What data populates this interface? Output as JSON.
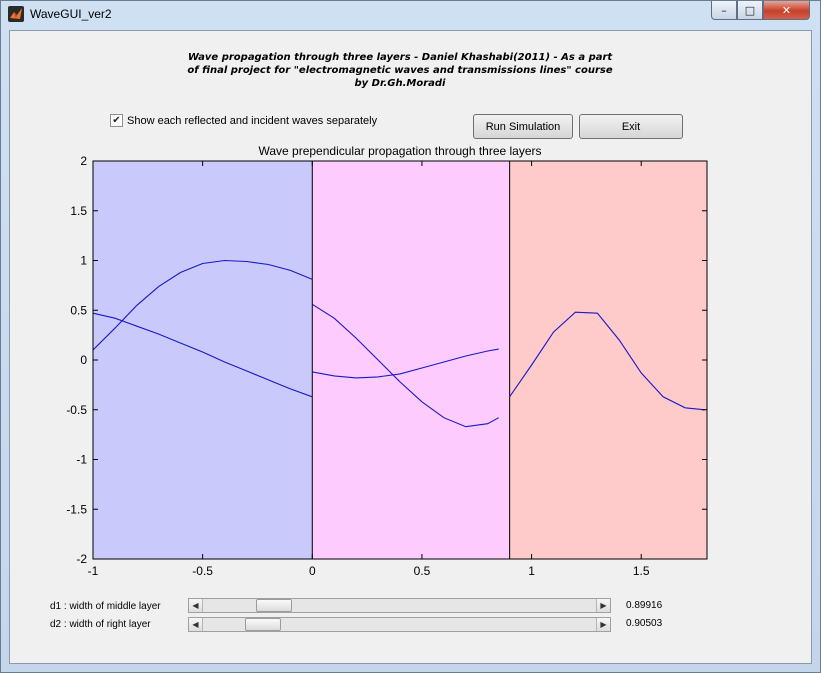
{
  "window": {
    "title": "WaveGUI_ver2",
    "minimize_glyph": "–",
    "maximize_glyph": "□",
    "close_glyph": "✕"
  },
  "header": {
    "line1": "Wave propagation through three layers - Daniel Khashabi(2011) - As a part",
    "line2": "of final project for \"electromagnetic waves and transmissions lines\" course",
    "line3": "by Dr.Gh.Moradi"
  },
  "controls": {
    "checkbox_label": "Show each reflected and incident waves separately",
    "checkbox_checked": true,
    "checkbox_glyph": "✔",
    "run_label": "Run Simulation",
    "exit_label": "Exit"
  },
  "chart_data": {
    "type": "line",
    "title": "Wave prependicular propagation through three layers",
    "xlim": [
      -1,
      1.8
    ],
    "ylim": [
      -2,
      2
    ],
    "x_ticks": [
      "-1",
      "-0.5",
      "0",
      "0.5",
      "1",
      "1.5"
    ],
    "x_tick_values": [
      -1,
      -0.5,
      0,
      0.5,
      1,
      1.5
    ],
    "y_ticks": [
      "2",
      "1.5",
      "1",
      "0.5",
      "0",
      "-0.5",
      "-1",
      "-1.5",
      "-2"
    ],
    "y_tick_values": [
      2,
      1.5,
      1,
      0.5,
      0,
      -0.5,
      -1,
      -1.5,
      -2
    ],
    "grid": false,
    "regions": [
      {
        "x_from": -1,
        "x_to": 0,
        "color": "#c9c9fb"
      },
      {
        "x_from": 0,
        "x_to": 0.9,
        "color": "#fecbfe"
      },
      {
        "x_from": 0.9,
        "x_to": 1.8,
        "color": "#fecbca"
      }
    ],
    "line_color": "#1818c8",
    "series": [
      {
        "x": [
          -1,
          -0.9,
          -0.8,
          -0.7,
          -0.6,
          -0.5,
          -0.4,
          -0.3,
          -0.2,
          -0.1,
          0
        ],
        "y": [
          0.1,
          0.32,
          0.55,
          0.74,
          0.88,
          0.97,
          1.0,
          0.99,
          0.96,
          0.9,
          0.81
        ]
      },
      {
        "x": [
          -1,
          -0.9,
          -0.8,
          -0.7,
          -0.6,
          -0.5,
          -0.4,
          -0.3,
          -0.2,
          -0.1,
          0
        ],
        "y": [
          0.47,
          0.42,
          0.34,
          0.26,
          0.17,
          0.08,
          -0.02,
          -0.11,
          -0.2,
          -0.29,
          -0.37
        ]
      },
      {
        "x": [
          0,
          0.1,
          0.2,
          0.3,
          0.4,
          0.5,
          0.6,
          0.7,
          0.8,
          0.85
        ],
        "y": [
          0.56,
          0.42,
          0.22,
          0.0,
          -0.22,
          -0.42,
          -0.58,
          -0.67,
          -0.64,
          -0.58
        ]
      },
      {
        "x": [
          0,
          0.1,
          0.2,
          0.3,
          0.4,
          0.5,
          0.6,
          0.7,
          0.8,
          0.85
        ],
        "y": [
          -0.12,
          -0.16,
          -0.18,
          -0.17,
          -0.14,
          -0.08,
          -0.02,
          0.04,
          0.09,
          0.11
        ]
      },
      {
        "x": [
          0.9,
          1.0,
          1.1,
          1.2,
          1.3,
          1.4,
          1.5,
          1.6,
          1.7,
          1.79
        ],
        "y": [
          -0.37,
          -0.05,
          0.28,
          0.48,
          0.47,
          0.2,
          -0.13,
          -0.37,
          -0.48,
          -0.5
        ]
      }
    ]
  },
  "sliders": [
    {
      "label": "d1 : width of middle layer",
      "value": "0.89916",
      "position": 0.15
    },
    {
      "label": "d2 : width of right layer",
      "value": "0.90503",
      "position": 0.12
    }
  ],
  "slider_left_glyph": "◀",
  "slider_right_glyph": "▶"
}
